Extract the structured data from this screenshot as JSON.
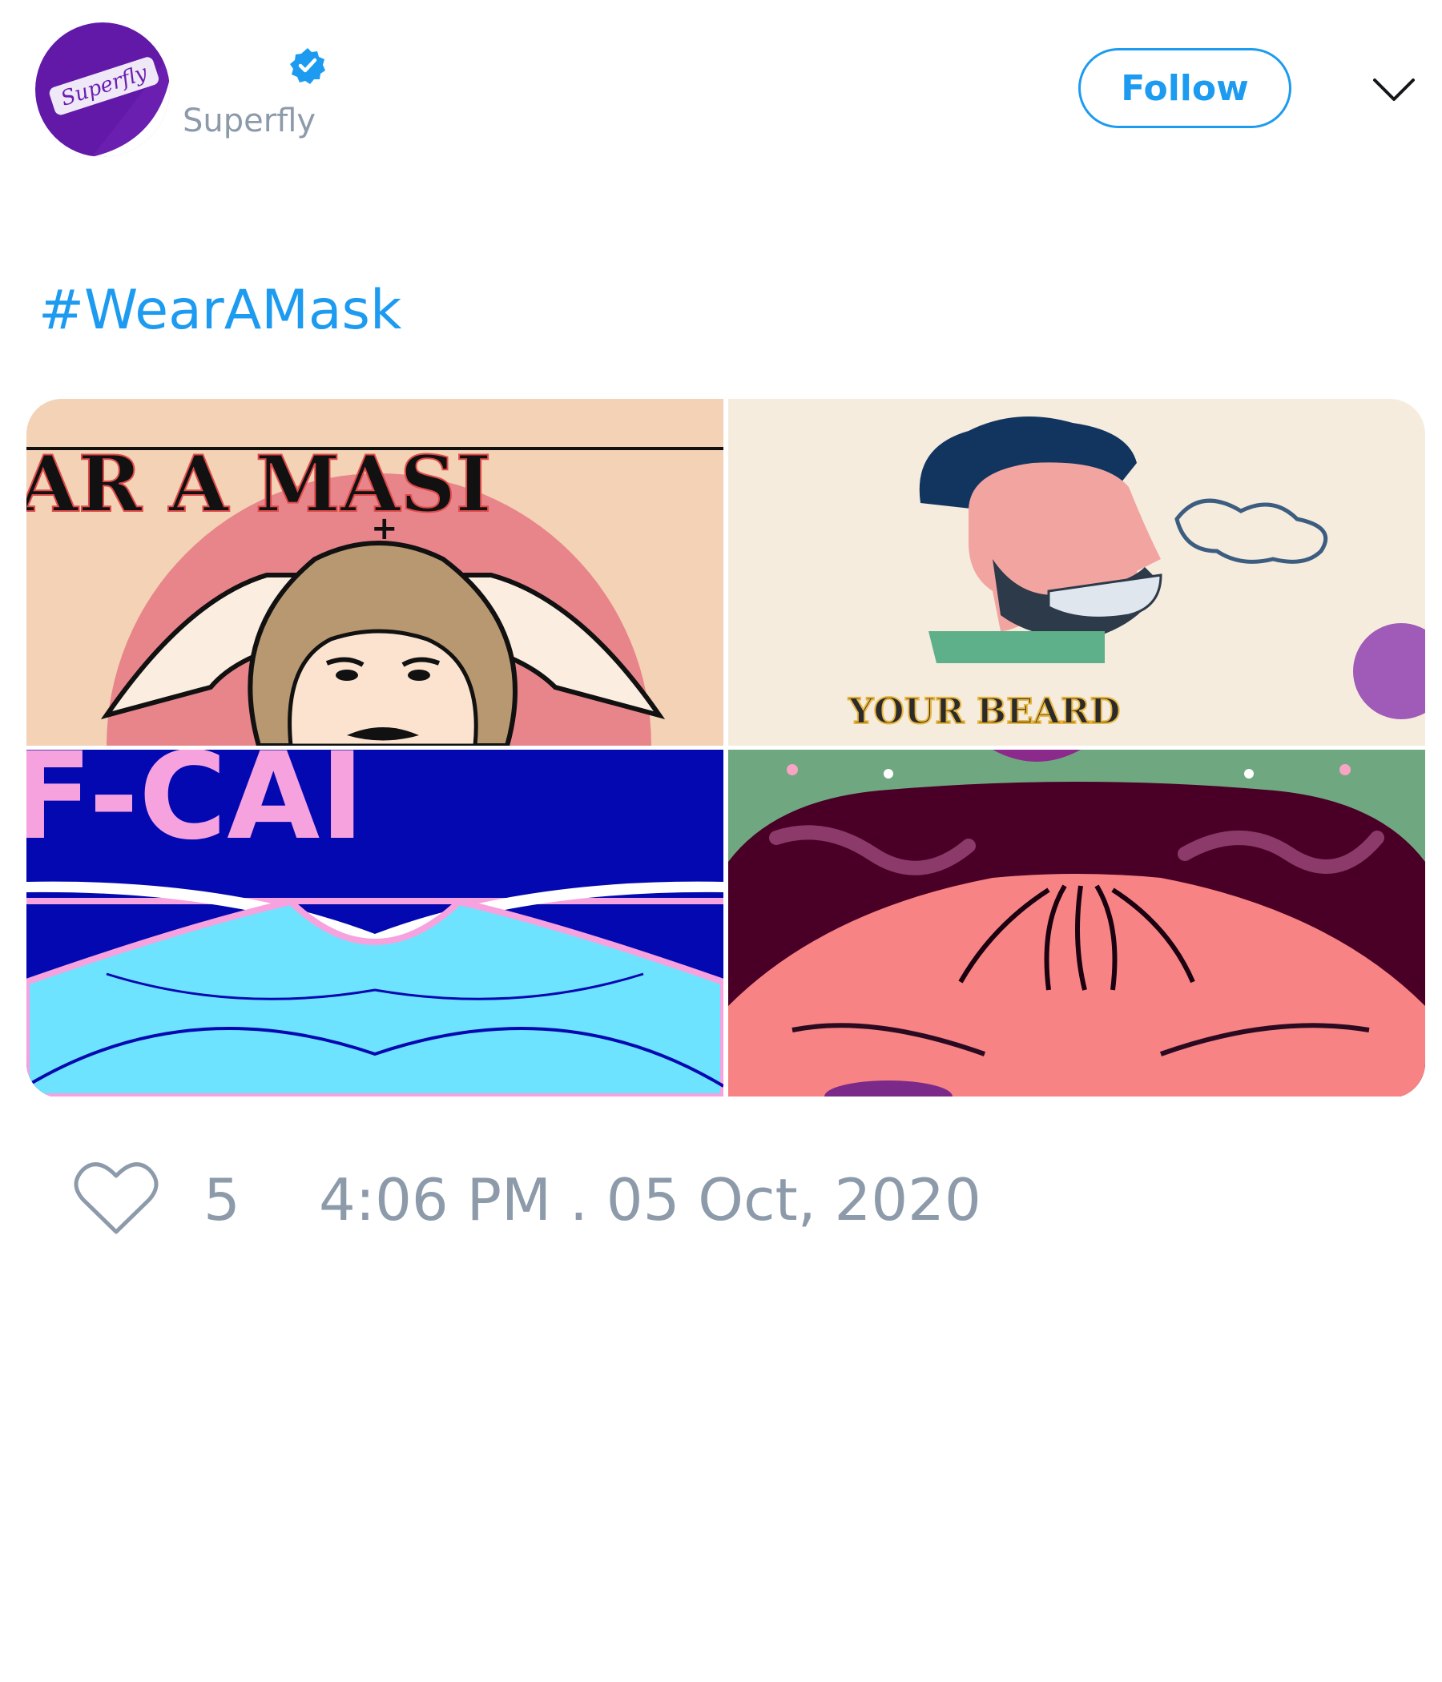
{
  "header": {
    "avatar_text": "Superfly",
    "display_name": "",
    "handle": "Superfly",
    "follow_label": "Follow",
    "verified_icon": "verified-badge-icon",
    "menu_icon": "chevron-down-icon"
  },
  "tweet": {
    "hashtag": "#WearAMask"
  },
  "media": {
    "tiles": [
      {
        "visible_text": "AR A MASI"
      },
      {
        "visible_text": "YOUR BEARD"
      },
      {
        "visible_text": "F-CAI"
      },
      {
        "visible_text": ""
      }
    ]
  },
  "footer": {
    "like_icon": "heart-icon",
    "like_count": "5",
    "timestamp": "4:06 PM . 05 Oct, 2020"
  },
  "colors": {
    "accent": "#1d9bf0",
    "muted": "#8c9aaa",
    "avatar_purple": "#6a1fb0"
  }
}
